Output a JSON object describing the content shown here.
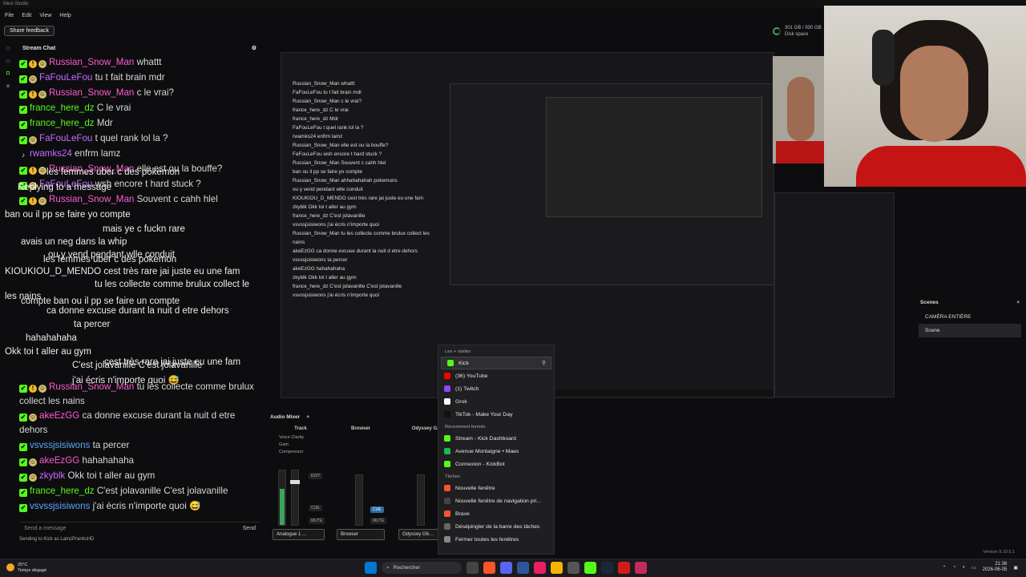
{
  "app": {
    "title": "Mesi Studio"
  },
  "menu": [
    "File",
    "Edit",
    "View",
    "Help"
  ],
  "share_feedback": "Share feedback",
  "disk": {
    "line1": "301 GB / 930 GB",
    "line2": "Disk space"
  },
  "chat": {
    "title": "Stream Chat",
    "messages": [
      {
        "user": "Russian_Snow_Man",
        "color": "#ff5bd0",
        "badges": [
          "kick",
          "warn",
          "smile"
        ],
        "text": "whattt"
      },
      {
        "user": "FaFouLeFou",
        "color": "#c86bff",
        "badges": [
          "kick",
          "smile"
        ],
        "text": "tu t fait brain mdr"
      },
      {
        "user": "Russian_Snow_Man",
        "color": "#ff5bd0",
        "badges": [
          "kick",
          "warn",
          "smile"
        ],
        "text": "c le vrai?"
      },
      {
        "user": "france_here_dz",
        "color": "#53fc18",
        "badges": [
          "kick"
        ],
        "text": "C le vrai"
      },
      {
        "user": "france_here_dz",
        "color": "#53fc18",
        "badges": [
          "kick"
        ],
        "text": "Mdr"
      },
      {
        "user": "FaFouLeFou",
        "color": "#c86bff",
        "badges": [
          "kick",
          "smile"
        ],
        "text": "t quel rank lol la ?"
      },
      {
        "user": "rwamks24",
        "color": "#c86bff",
        "badges": [
          "tiktok"
        ],
        "text": "enfrm lamz"
      },
      {
        "user": "Russian_Snow_Man",
        "color": "#ff5bd0",
        "badges": [
          "kick",
          "warn",
          "smile"
        ],
        "text": "elle est ou la bouffe?"
      },
      {
        "user": "FaFouLeFou",
        "color": "#c86bff",
        "badges": [
          "kick",
          "smile"
        ],
        "text": "wsh encore t hard stuck ?"
      },
      {
        "user": "Russian_Snow_Man",
        "color": "#ff5bd0",
        "badges": [
          "kick",
          "warn",
          "smile"
        ],
        "text": "Souvent c cahh hlel"
      },
      {
        "user": "",
        "color": "#ffffff",
        "badges": [],
        "text": ""
      },
      {
        "user": "",
        "color": "#ffffff",
        "badges": [],
        "text": ""
      },
      {
        "user": "",
        "color": "#ffffff",
        "badges": [],
        "text": ""
      },
      {
        "user": "",
        "color": "#ffffff",
        "badges": [],
        "text": ""
      },
      {
        "user": "",
        "color": "#ffffff",
        "badges": [],
        "text": ""
      },
      {
        "user": "",
        "color": "#ffffff",
        "badges": [],
        "text": ""
      },
      {
        "user": "",
        "color": "#ffffff",
        "badges": [],
        "text": ""
      },
      {
        "user": "vsvssjsisiwons",
        "color": "#5aa7ff",
        "badges": [
          "kick"
        ],
        "text": "ta percer"
      },
      {
        "user": "Russian_Snow_Man",
        "color": "#ff5bd0",
        "badges": [
          "kick",
          "warn",
          "smile"
        ],
        "text": "ahhahahahah pokemons"
      },
      {
        "user": "akeEzGG",
        "color": "#ff5bd0",
        "badges": [
          "kick",
          "smile"
        ],
        "text": "ou y vend pendant wlle conduit"
      },
      {
        "user": "zkyblk",
        "color": "#c86bff",
        "badges": [
          "kick",
          "smile"
        ],
        "text": "Okk toi t aller au gym"
      },
      {
        "user": "france_here_dz",
        "color": "#53fc18",
        "badges": [
          "kick"
        ],
        "text": "C'est jolavanille C'est jolavanille"
      },
      {
        "user": "vsvssjsisiwons",
        "color": "#5aa7ff",
        "badges": [
          "kick"
        ],
        "text": "j'ai écris n'importe quoi 😅"
      }
    ],
    "tail": [
      {
        "user": "Russian_Snow_Man",
        "color": "#ff5bd0",
        "badges": [
          "kick",
          "warn",
          "smile"
        ],
        "text": "tu les collecte comme brulux collect les nains"
      },
      {
        "user": "akeEzGG",
        "color": "#ff5bd0",
        "badges": [
          "kick",
          "smile"
        ],
        "text": "ca donne excuse durant la nuit d etre dehors"
      },
      {
        "user": "vsvssjsisiwons",
        "color": "#5aa7ff",
        "badges": [
          "kick"
        ],
        "text": "ta percer"
      },
      {
        "user": "akeEzGG",
        "color": "#ff5bd0",
        "badges": [
          "kick",
          "smile"
        ],
        "text": "hahahahaha"
      },
      {
        "user": "zkyblk",
        "color": "#c86bff",
        "badges": [
          "kick",
          "smile"
        ],
        "text": "Okk toi t aller au gym"
      },
      {
        "user": "france_here_dz",
        "color": "#53fc18",
        "badges": [
          "kick"
        ],
        "text": "C'est jolavanille C'est jolavanille"
      },
      {
        "user": "vsvssjsisiwons",
        "color": "#5aa7ff",
        "badges": [
          "kick"
        ],
        "text": "j'ai écris n'importe quoi 😅"
      }
    ],
    "overlay": [
      "les femmes uber c des pokemon",
      "Replying to a message",
      "ban ou il pp se faire yo compte",
      "mais ye c fuckn rare",
      "avais un neg dans la whip",
      "ou y vend pendant wlle conduit",
      "les femmes uber c des pokemon",
      "KIOUKIOU_D_MENDO cest très rare jai juste eu une fam",
      "tu les collecte comme brulux collect le",
      "les nains",
      "compte ban ou il pp se faire un compte",
      "ca donne excuse durant la nuit d etre dehors",
      "ta percer",
      "hahahahaha",
      "Okk toi t aller au gym",
      "cest très rare jai juste eu une fam",
      "C'est jolavanille C'est jolavanille",
      "j'ai écris n'importe quoi 😅"
    ],
    "input_placeholder": "Send a message",
    "send_label": "Send",
    "status": "Sending to Kick as LamzPranksHD"
  },
  "preview_chat": [
    "Russian_Snow_Man whattt",
    "FaFouLeFou tu t fait brain mdr",
    "Russian_Snow_Man c le vrai?",
    "france_here_dz C le vrai",
    "france_here_dz Mdr",
    "FaFouLeFou t quel rank lol la ?",
    "rwamks24 enfrm lamz",
    "Russian_Snow_Man elle est ou la bouffe?",
    "FaFouLeFou wsh encore t hard stuck ?",
    "Russian_Snow_Man Souvent c cahh hlel",
    "ban ou il pp se faire yo compte",
    "Russian_Snow_Man ahhahahahah pokemons",
    "ou y vend pendant wlle conduit",
    "KIOUKIOU_D_MENDO cest très rare jai juste eu une fam",
    "zkyblk Okk toi t aller au gym",
    "france_here_dz C'est jolavanille",
    "vsvssjsisiwons j'ai écris n'importe quoi",
    "Russian_Snow_Man tu les collecte comme brulux collect les nains",
    "akeEzGG ca donne excuse durant la nuit d etre dehors",
    "vsvssjsisiwons ta percer",
    "akeEzGG hahahahaha",
    "zkyblk Okk toi t aller au gym",
    "france_here_dz C'est jolavanille C'est jolavanille",
    "vsvssjsisiwons j'ai écris n'importe quoi"
  ],
  "scenes": {
    "title": "Scenes",
    "items": [
      "CAMÉRA ENTIÈRE",
      "Scene"
    ]
  },
  "mixer": {
    "title": "Audio Mixer",
    "tracks": [
      {
        "name": "Track",
        "filters": [
          "Voice Clarity",
          "Gain",
          "Compressor"
        ],
        "source": "Analogue 1 ..."
      },
      {
        "name": "Browser",
        "filters": [],
        "source": "Browser"
      },
      {
        "name": "Odyssey G...",
        "filters": [],
        "source": "Odyssey G6..."
      }
    ],
    "btn_edit": "EDIT",
    "btn_mute": "MUTE",
    "btn_cue": "CUE"
  },
  "jumplist": {
    "section_frequent": "Les + visités",
    "frequent": [
      {
        "label": "Kick",
        "color": "#53fc18",
        "selected": true
      },
      {
        "label": "(36) YouTube",
        "color": "#ff0000",
        "selected": false
      },
      {
        "label": "(1) Twitch",
        "color": "#9146ff",
        "selected": false
      },
      {
        "label": "Grok",
        "color": "#ffffff",
        "selected": false
      },
      {
        "label": "TikTok - Make Your Day",
        "color": "#111111",
        "selected": false
      }
    ],
    "section_recent": "Récemment fermés",
    "recent": [
      {
        "label": "Stream - Kick Dashboard",
        "color": "#53fc18"
      },
      {
        "label": "Avenue Montaigne • Maes",
        "color": "#1db954"
      },
      {
        "label": "Connexion - KickBot",
        "color": "#53fc18"
      }
    ],
    "section_tasks": "Tâches",
    "tasks": [
      {
        "label": "Nouvelle fenêtre",
        "color": "#fb542b"
      },
      {
        "label": "Nouvelle fenêtre de navigation pri...",
        "color": "#444444"
      },
      {
        "label": "Brave",
        "color": "#fb542b"
      },
      {
        "label": "Désépingler de la barre des tâches",
        "color": "#666666"
      },
      {
        "label": "Fermer toutes les fenêtres",
        "color": "#888888"
      }
    ]
  },
  "taskbar": {
    "weather_temp": "25°C",
    "weather_desc": "Temps dégagé",
    "search": "Rechercher",
    "time": "21:36",
    "date": "2026-06-05"
  },
  "version": "Version 9.10.5.1"
}
